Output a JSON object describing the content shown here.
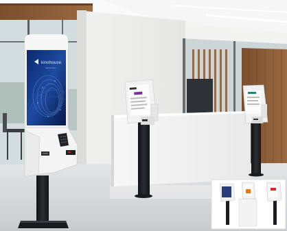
{
  "scene": {
    "description_type": "photo",
    "main_kiosk": {
      "screen_brand": "kinohouse",
      "screen_tagline": "self-service"
    },
    "colors": {
      "wall": "#ececeb",
      "wood": "#8a5a35",
      "floor": "#d9dadb",
      "kiosk_white": "#f4f4f4",
      "kiosk_black": "#1c1d20",
      "screen_blue": "#0d2e78",
      "window_glass": "#b8c7c9"
    }
  }
}
